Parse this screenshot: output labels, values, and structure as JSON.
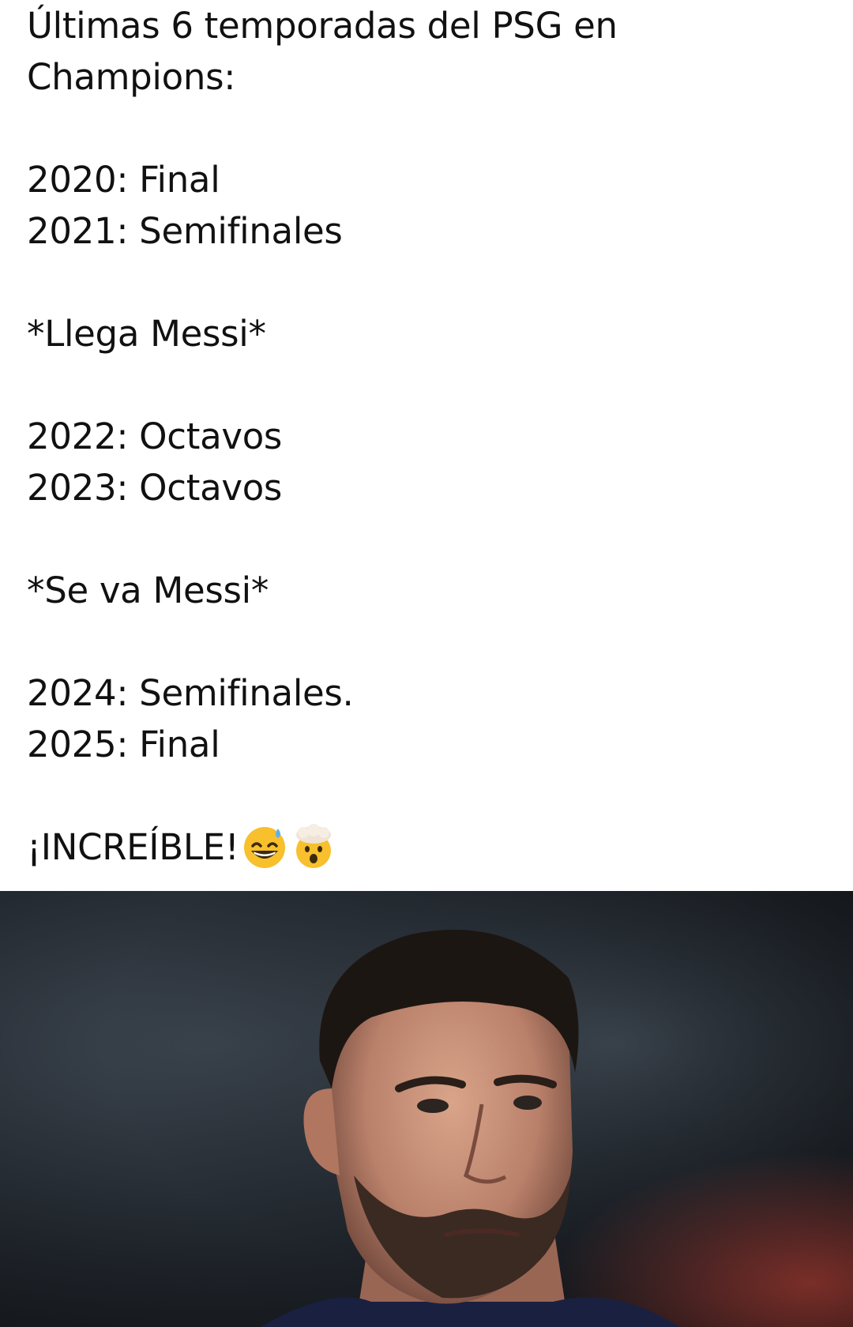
{
  "post": {
    "title_line1": "Últimas 6 temporadas del PSG en",
    "title_line2": "Champions:",
    "seasons_before": [
      {
        "text": "2020: Final"
      },
      {
        "text": "2021: Semifinales"
      }
    ],
    "event_arrival": "*Llega Messi*",
    "seasons_during": [
      {
        "text": "2022: Octavos"
      },
      {
        "text": "2023: Octavos"
      }
    ],
    "event_departure": "*Se va Messi*",
    "seasons_after": [
      {
        "text": "2024: Semifinales."
      },
      {
        "text": "2025: Final"
      }
    ],
    "closing": "¡INCREÍBLE!",
    "closing_emojis": [
      "grinning-sweat-emoji",
      "exploding-head-emoji"
    ]
  },
  "colors": {
    "text": "#111111",
    "background": "#ffffff",
    "photo_background": "#1d2228",
    "emoji_yellow": "#f7c02c",
    "jersey_navy": "#1a2040"
  }
}
